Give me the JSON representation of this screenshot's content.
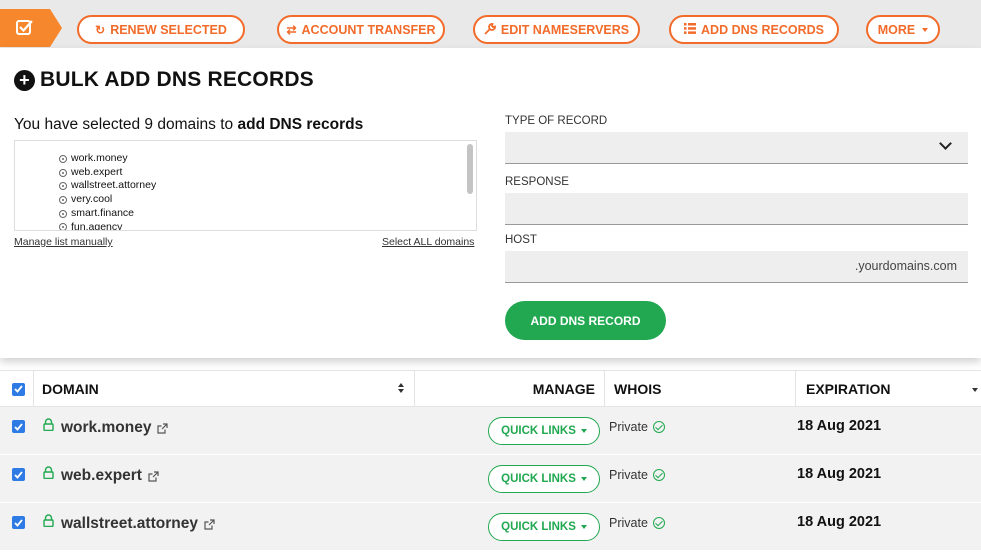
{
  "toolbar": {
    "renew_label": "RENEW SELECTED",
    "transfer_label": "ACCOUNT TRANSFER",
    "nameservers_label": "EDIT NAMESERVERS",
    "dns_label": "ADD DNS RECORDS",
    "more_label": "MORE",
    "accent": "#f26b2a"
  },
  "panel": {
    "title": "BULK ADD DNS RECORDS",
    "selected_prefix": "You have selected 9 domains to ",
    "selected_action": "add DNS records",
    "domains": [
      "work.money",
      "web.expert",
      "wallstreet.attorney",
      "very.cool",
      "smart.finance",
      "fun.agency"
    ],
    "manage_link": "Manage list manually",
    "select_all_link": "Select ALL domains",
    "type_label": "TYPE OF RECORD",
    "type_value": "",
    "response_label": "RESPONSE",
    "response_value": "",
    "host_label": "HOST",
    "host_suffix": ".yourdomains.com",
    "add_button": "ADD DNS RECORD"
  },
  "table": {
    "headers": {
      "domain": "DOMAIN",
      "manage": "MANAGE",
      "whois": "WHOIS",
      "expiration": "EXPIRATION"
    },
    "rows": [
      {
        "domain": "work.money",
        "quick_links": "QUICK LINKS",
        "whois": "Private",
        "expiration": "18 Aug 2021"
      },
      {
        "domain": "web.expert",
        "quick_links": "QUICK LINKS",
        "whois": "Private",
        "expiration": "18 Aug 2021"
      },
      {
        "domain": "wallstreet.attorney",
        "quick_links": "QUICK LINKS",
        "whois": "Private",
        "expiration": "18 Aug 2021"
      }
    ],
    "checkbox_color": "#2f7be5",
    "green": "#21a850"
  }
}
